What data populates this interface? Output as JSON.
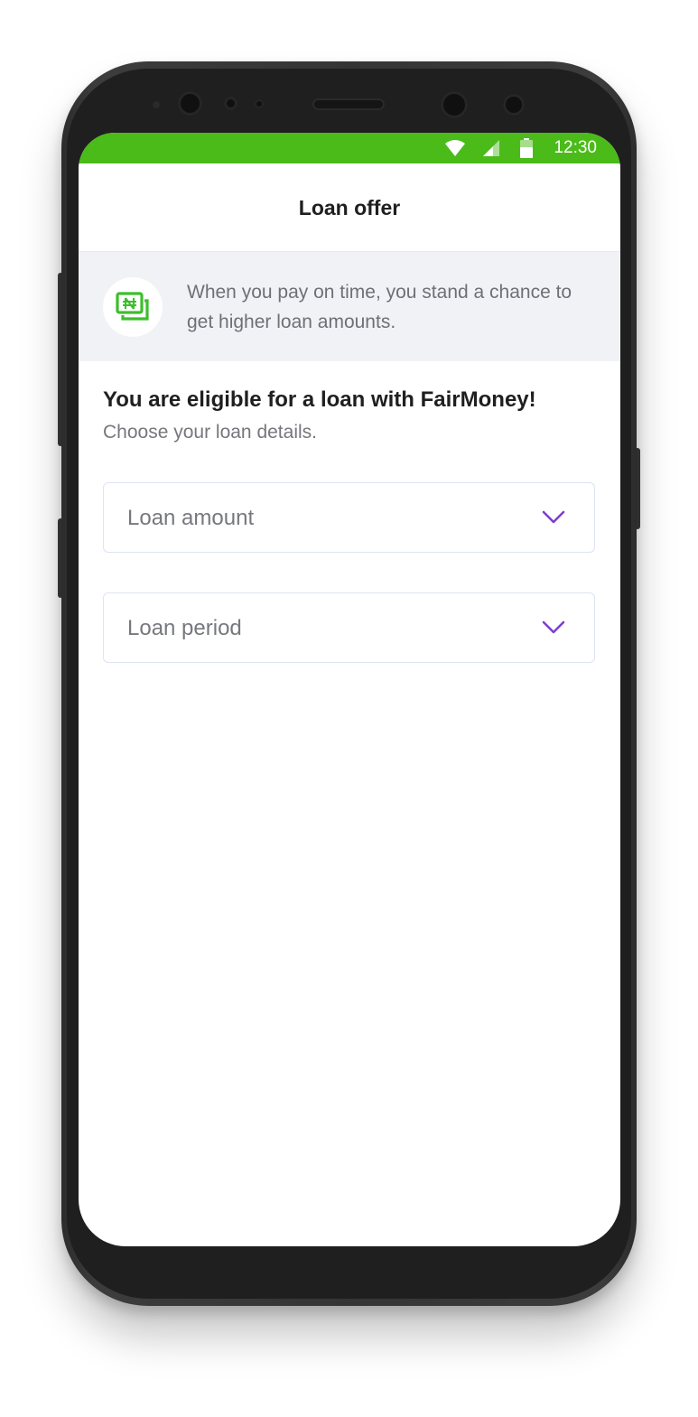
{
  "status_bar": {
    "time": "12:30",
    "bg_color": "#4bbb19",
    "icons": [
      "wifi-icon",
      "signal-icon",
      "battery-icon"
    ]
  },
  "header": {
    "title": "Loan offer"
  },
  "info_banner": {
    "icon": "naira-cash-icon",
    "icon_color": "#3cbf2c",
    "text": "When you pay on time, you stand a chance to get higher loan amounts."
  },
  "main": {
    "title": "You are eligible for a loan with FairMoney!",
    "subtitle": "Choose your loan details.",
    "fields": [
      {
        "placeholder": "Loan amount",
        "icon": "chevron-down-icon"
      },
      {
        "placeholder": "Loan period",
        "icon": "chevron-down-icon"
      }
    ],
    "accent_color": "#7b3fd1"
  }
}
